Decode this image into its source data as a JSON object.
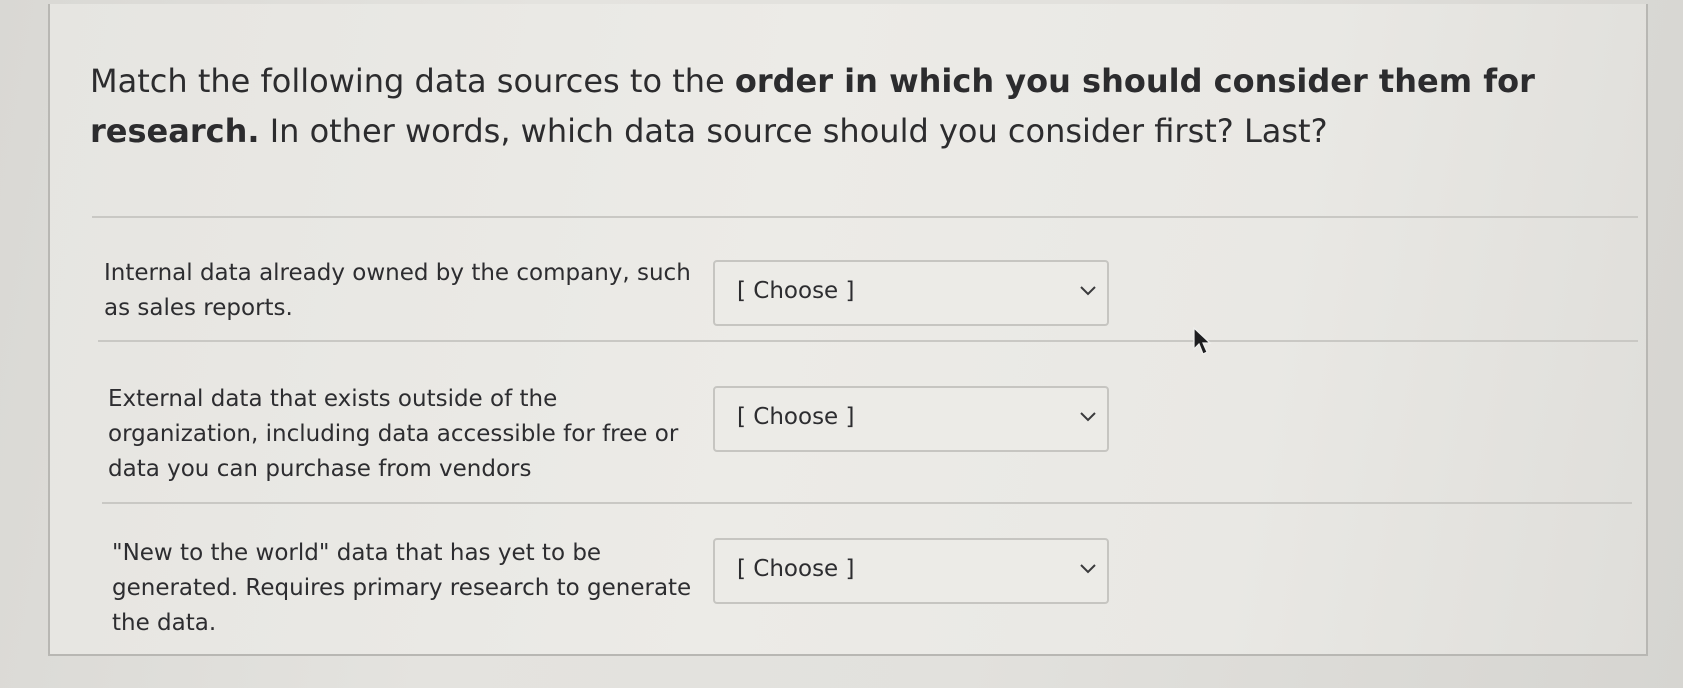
{
  "question": {
    "text_before": "Match the following data sources to the ",
    "text_bold": "order in which you should consider them for research.",
    "text_after": " In other words, which data source should you consider first? Last?"
  },
  "rows": [
    {
      "label": "Internal data already owned by the company, such as sales reports.",
      "select_value": "[ Choose ]"
    },
    {
      "label": "External data that exists outside of the organization, including data accessible for free or data you can purchase from vendors",
      "select_value": "[ Choose ]"
    },
    {
      "label": "\"New to the world\" data that has yet to be generated. Requires primary research to generate the data.",
      "select_value": "[ Choose ]"
    }
  ],
  "icons": {
    "select_arrow": "chevron-down-icon",
    "pointer": "mouse-cursor-icon"
  },
  "colors": {
    "text": "#2c2c2e",
    "border": "#c6c5c1",
    "background": "#e9e8e4"
  }
}
